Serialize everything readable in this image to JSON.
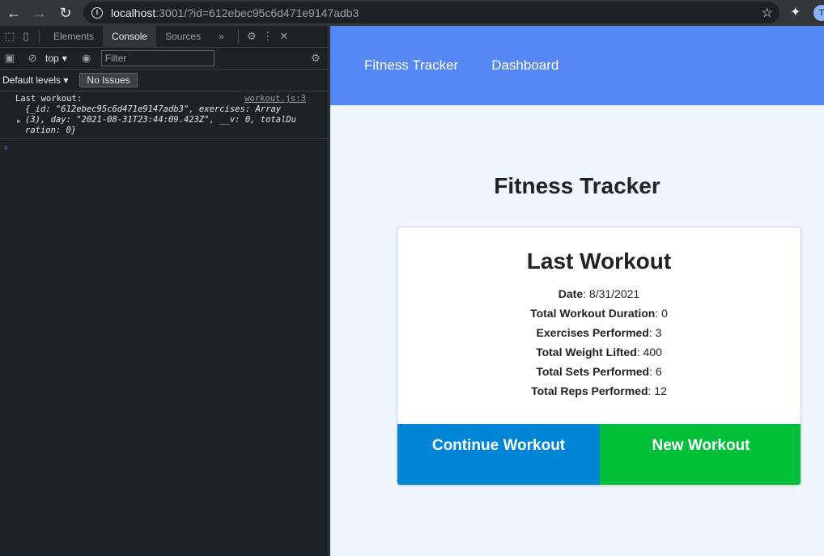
{
  "browser": {
    "url_host": "localhost",
    "url_rest": ":3001/?id=612ebec95c6d471e9147adb3",
    "avatar_letter": "T"
  },
  "devtools": {
    "tabs": [
      "Elements",
      "Console",
      "Sources"
    ],
    "more_tabs": "»",
    "context": "top",
    "filter_placeholder": "Filter",
    "levels": "Default levels",
    "issues": "No Issues",
    "log": {
      "label": "Last workout:",
      "source": "workout.js:3",
      "line1": "{_id: \"612ebec95c6d471e9147adb3\", exercises: Array",
      "line2": "(3), day: \"2021-08-31T23:44:09.423Z\", __v: 0, totalDu",
      "line3": "ration: 0}"
    }
  },
  "site": {
    "nav": [
      "Fitness Tracker",
      "Dashboard"
    ],
    "heading": "Fitness Tracker",
    "card_title": "Last Workout",
    "stats": [
      {
        "label": "Date",
        "value": ": 8/31/2021"
      },
      {
        "label": "Total Workout Duration",
        "value": ": 0"
      },
      {
        "label": "Exercises Performed",
        "value": ": 3"
      },
      {
        "label": "Total Weight Lifted",
        "value": ": 400"
      },
      {
        "label": "Total Sets Performed",
        "value": ": 6"
      },
      {
        "label": "Total Reps Performed",
        "value": ": 12"
      }
    ],
    "continue_label": "Continue Workout",
    "new_label": "New Workout"
  },
  "colors": {
    "nav_bg": "#5588f5",
    "continue_bg": "#0084d6",
    "new_bg": "#00c03a"
  }
}
